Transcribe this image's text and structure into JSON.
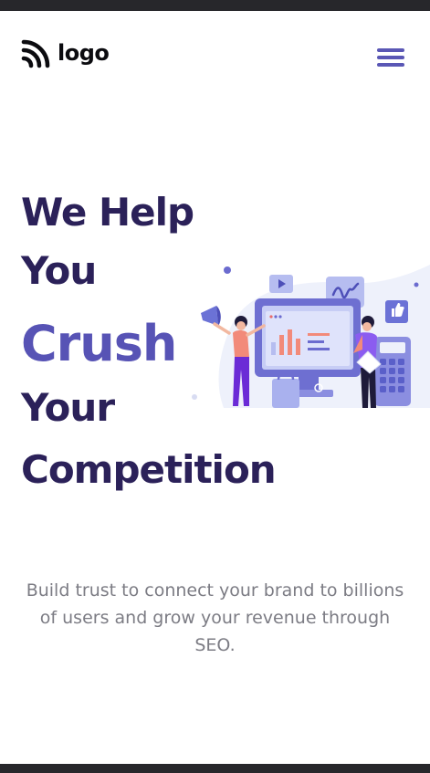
{
  "header": {
    "logo_text": "logo",
    "menu_icon": "hamburger-menu-icon",
    "logo_icon": "rss-arcs-logo-icon"
  },
  "hero": {
    "title_lines": [
      "We Help",
      "You",
      "Crush",
      "Your",
      "Competition"
    ],
    "subtitle": "Build trust to connect your brand to billions of users and grow your revenue through SEO.",
    "illustration": "marketing-team-illustration"
  },
  "colors": {
    "title": "#2b2159",
    "accent": "#5753b5",
    "subtitle": "#7c7c84",
    "bars": "#27272b"
  }
}
